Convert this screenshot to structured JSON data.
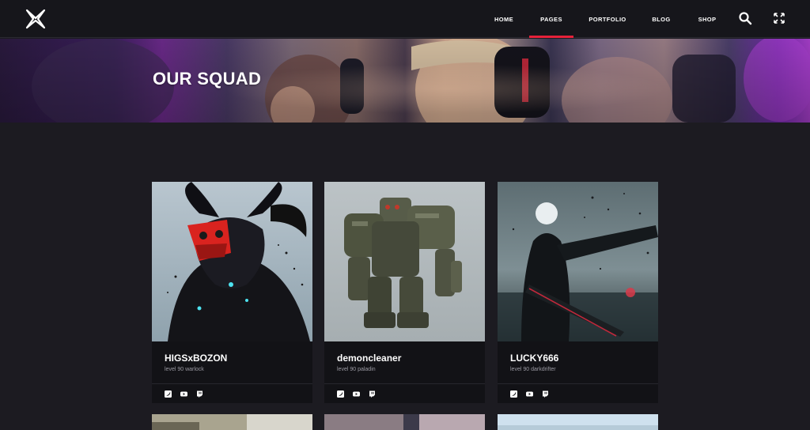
{
  "header": {
    "logo": "brand-logo",
    "nav": [
      {
        "label": "HOME",
        "active": false
      },
      {
        "label": "PAGES",
        "active": true
      },
      {
        "label": "PORTFOLIO",
        "active": false
      },
      {
        "label": "BLOG",
        "active": false
      },
      {
        "label": "SHOP",
        "active": false
      }
    ],
    "icons": [
      "search-icon",
      "fullscreen-icon"
    ],
    "accent": "#e6213a"
  },
  "banner": {
    "title": "OUR SQUAD"
  },
  "squad": [
    {
      "name": "HIGSxBOZON",
      "subtitle": "level 90 warlock",
      "socials": [
        "twitter-icon",
        "youtube-icon",
        "twitch-icon"
      ]
    },
    {
      "name": "demoncleaner",
      "subtitle": "level 90 paladin",
      "socials": [
        "twitter-icon",
        "youtube-icon",
        "twitch-icon"
      ]
    },
    {
      "name": "LUCKY666",
      "subtitle": "level 90 darkdrifter",
      "socials": [
        "twitter-icon",
        "youtube-icon",
        "twitch-icon"
      ]
    }
  ]
}
